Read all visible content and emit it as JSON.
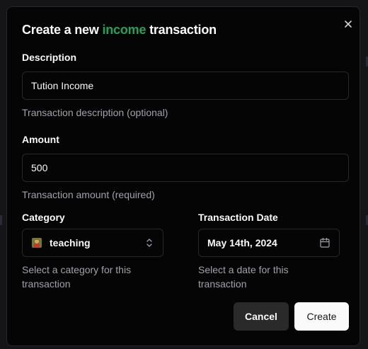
{
  "dialog": {
    "title_prefix": "Create a new ",
    "title_accent": "income",
    "title_suffix": " transaction",
    "accent_color": "#22a35a",
    "close_icon": "close-icon"
  },
  "form": {
    "description": {
      "label": "Description",
      "value": "Tution Income",
      "help": "Transaction description (optional)"
    },
    "amount": {
      "label": "Amount",
      "value": "500",
      "help": "Transaction amount (required)"
    },
    "category": {
      "label": "Category",
      "value": "teaching",
      "icon": "teacher-emoji-icon",
      "help": "Select a category for this transaction"
    },
    "date": {
      "label": "Transaction Date",
      "value": "May 14th, 2024",
      "icon": "calendar-icon",
      "help": "Select a date for this transaction"
    }
  },
  "actions": {
    "cancel_label": "Cancel",
    "create_label": "Create"
  }
}
